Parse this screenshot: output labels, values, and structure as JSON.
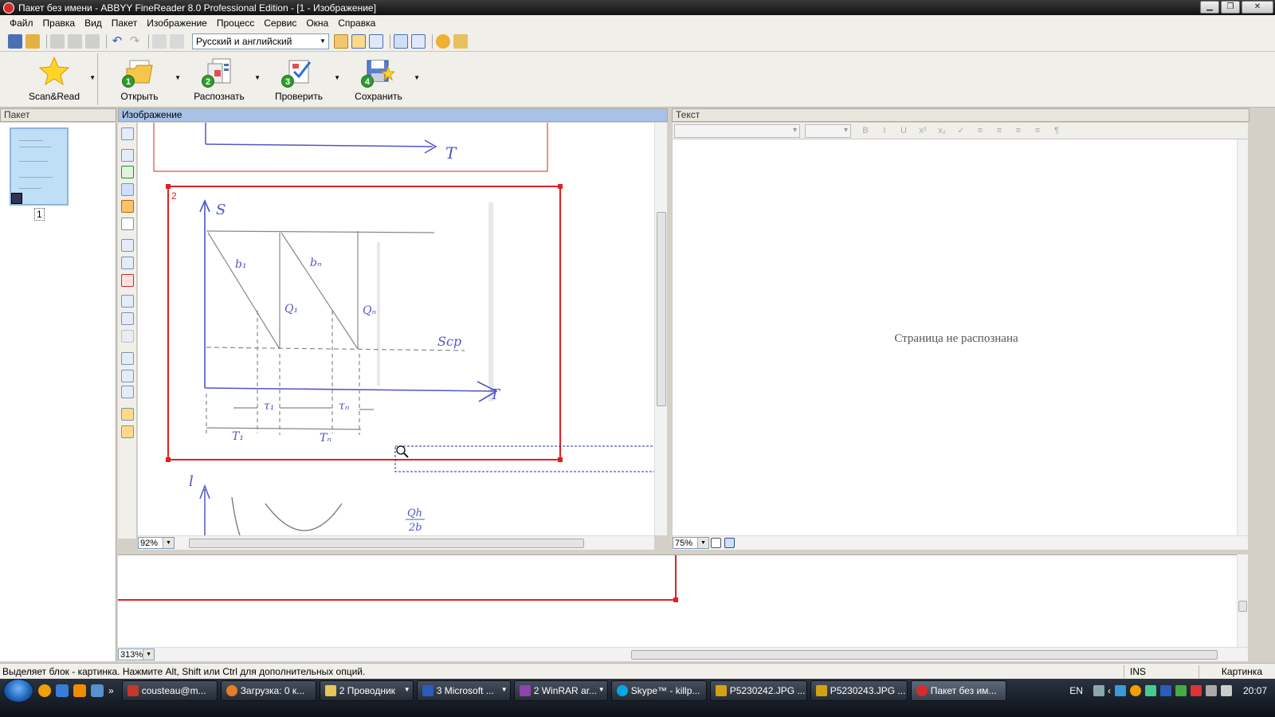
{
  "window": {
    "title": "Пакет без имени - ABBYY FineReader 8.0 Professional Edition - [1 - Изображение]"
  },
  "menu": [
    "Файл",
    "Правка",
    "Вид",
    "Пакет",
    "Изображение",
    "Процесс",
    "Сервис",
    "Окна",
    "Справка"
  ],
  "toolbar": {
    "language": "Русский и английский"
  },
  "bigbuttons": [
    {
      "label": "Scan&Read",
      "num": ""
    },
    {
      "label": "Открыть",
      "num": "1"
    },
    {
      "label": "Распознать",
      "num": "2"
    },
    {
      "label": "Проверить",
      "num": "3"
    },
    {
      "label": "Сохранить",
      "num": "4"
    }
  ],
  "panels": {
    "batch": {
      "title": "Пакет",
      "page_number": "1"
    },
    "image": {
      "title": "Изображение",
      "zoom": "92%"
    },
    "text": {
      "title": "Текст",
      "zoom": "75%",
      "placeholder_message": "Страница не распознана"
    },
    "zoom_window": {
      "zoom": "313%"
    }
  },
  "image_blocks": [
    {
      "label": "2",
      "type": "picture"
    }
  ],
  "drawing_labels": {
    "axis_s": "S",
    "axis_t1": "T",
    "axis_t2": "T",
    "b1": "b₁",
    "bn": "bₙ",
    "q1": "Q₁",
    "qn": "Qₙ",
    "scp": "Sсp",
    "tau1": "τ₁",
    "taun": "τₙ",
    "T1": "T₁",
    "Tn": "Tₙ",
    "l": "l",
    "qh": "Qh",
    "qh_den": "2b"
  },
  "status": {
    "message": "Выделяет блок - картинка. Нажмите Alt, Shift или Ctrl для дополнительных опций.",
    "ins": "INS",
    "mode": "Картинка"
  },
  "taskbar": {
    "tasks": [
      {
        "label": "cousteau@m...",
        "color": "#c0392b"
      },
      {
        "label": "Загрузка: 0 к...",
        "color": "#e67e22"
      },
      {
        "label": "2 Проводник",
        "color": "#e8c45a"
      },
      {
        "label": "3 Microsoft ...",
        "color": "#2b5cb8"
      },
      {
        "label": "2 WinRAR ar...",
        "color": "#8e44ad"
      },
      {
        "label": "Skype™ - killp...",
        "color": "#00a8e8"
      },
      {
        "label": "P5230242.JPG ...",
        "color": "#d4a017"
      },
      {
        "label": "P5230243.JPG ...",
        "color": "#d4a017"
      },
      {
        "label": "Пакет без им...",
        "color": "#d62b2b"
      }
    ],
    "lang": "EN",
    "clock": "20:07"
  },
  "colors": {
    "block_red": "#e02020",
    "ink_blue": "#4a4ad0",
    "selection_blue": "#a8c2e8"
  }
}
